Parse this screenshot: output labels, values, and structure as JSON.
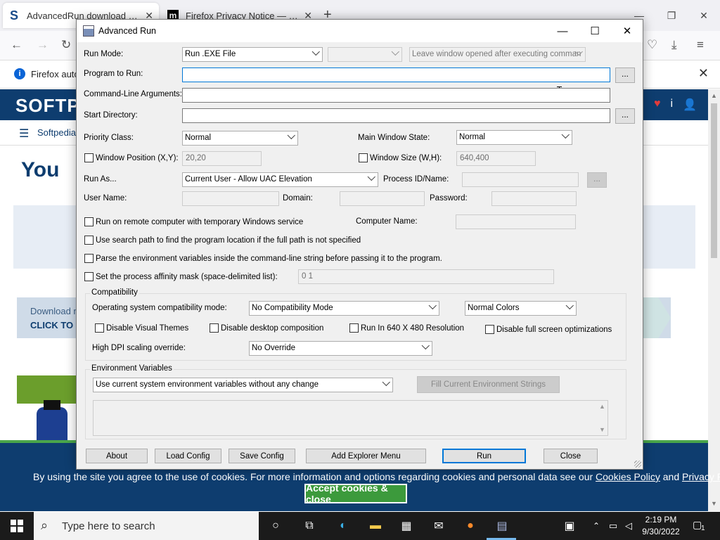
{
  "browser": {
    "tabs": [
      {
        "title": "AdvancedRun download starting",
        "favicon": "S",
        "active": true
      },
      {
        "title": "Firefox Privacy Notice — Mozilla",
        "favicon": "m",
        "active": false
      }
    ],
    "notification_text": "Firefox autom"
  },
  "page": {
    "logo": "SOFTP",
    "nav_label": "Softpedia",
    "headline": "You",
    "download_line1": "Download n",
    "download_line2": "CLICK TO",
    "cookie": {
      "text_before": "By using the site you agree to the use of cookies. For more information and options regarding cookies and personal data see our",
      "link1": "Cookies Policy",
      "and": "and",
      "link2": "Privacy Policy",
      "accept": "Accept cookies & close"
    }
  },
  "dialog": {
    "title": "Advanced Run",
    "run_mode_label": "Run Mode:",
    "run_mode_value": "Run .EXE File",
    "second_combo_value": "",
    "leave_window_value": "Leave window opened after executing comman",
    "program_label": "Program to Run:",
    "program_value": "",
    "cmdline_label": "Command-Line Arguments:",
    "cmdline_value": "",
    "startdir_label": "Start Directory:",
    "startdir_value": "",
    "browse": "...",
    "priority_label": "Priority Class:",
    "priority_value": "Normal",
    "mainwin_label": "Main Window State:",
    "mainwin_value": "Normal",
    "winpos_label": "Window Position (X,Y):",
    "winpos_value": "20,20",
    "winsize_label": "Window Size (W,H):",
    "winsize_value": "640,400",
    "runas_label": "Run As...",
    "runas_value": "Current User - Allow UAC Elevation",
    "pid_label": "Process ID/Name:",
    "pid_value": "",
    "username_label": "User Name:",
    "domain_label": "Domain:",
    "password_label": "Password:",
    "remote_label": "Run on remote computer with temporary Windows service",
    "computer_label": "Computer Name:",
    "searchpath_label": "Use search path to find the program location if the full path is not specified",
    "parseenv_label": "Parse the environment variables inside the command-line string before passing it to the program.",
    "affinity_label": "Set the process affinity mask (space-delimited list):",
    "affinity_value": "0 1",
    "compat_group": "Compatibility",
    "os_compat_label": "Operating system compatibility mode:",
    "os_compat_value": "No Compatibility Mode",
    "colors_value": "Normal Colors",
    "disable_themes": "Disable Visual Themes",
    "disable_desktop": "Disable desktop composition",
    "run_640": "Run In 640 X 480 Resolution",
    "disable_fullscreen": "Disable full screen optimizations",
    "dpi_label": "High DPI scaling override:",
    "dpi_value": "No Override",
    "env_group": "Environment Variables",
    "env_value": "Use current system environment variables without any change",
    "fill_env": "Fill Current Environment Strings",
    "buttons": {
      "about": "About",
      "load": "Load Config",
      "save": "Save Config",
      "explorer": "Add Explorer Menu",
      "run": "Run",
      "close": "Close"
    }
  },
  "taskbar": {
    "search_placeholder": "Type here to search",
    "time": "2:19 PM",
    "date": "9/30/2022",
    "notification_count": "1"
  }
}
